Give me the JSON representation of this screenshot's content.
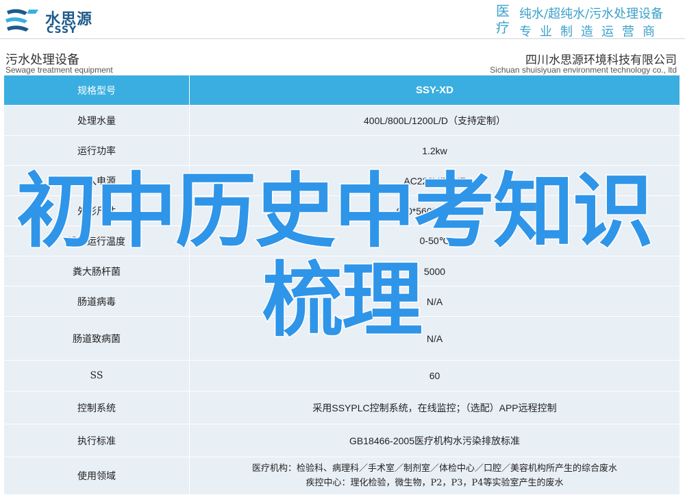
{
  "header": {
    "logo_cn": "水思源",
    "logo_en": "CSSY",
    "side_char_1": "医",
    "side_char_2": "疗",
    "tagline_1": "纯水/超纯水/污水处理设备",
    "tagline_2": "专业制造运营商"
  },
  "title": {
    "left_cn": "污水处理设备",
    "left_en": "Sewage treatment equipment",
    "right_cn": "四川水思源环境科技有限公司",
    "right_en": "Sichuan shuisiyuan environment technology co., ltd"
  },
  "table": {
    "header": {
      "label": "规格型号",
      "value": "SSY-XD"
    },
    "rows": [
      {
        "label": "处理水量",
        "value": "400L/800L/1200L/D（支持定制）"
      },
      {
        "label": "运行功率",
        "value": "1.2kw"
      },
      {
        "label": "输入电源",
        "value": "AC220V/50HZ"
      },
      {
        "label": "外形尺寸",
        "value": "680*560*1440mm"
      },
      {
        "label": "设备运行温度",
        "value": "0-50℃"
      },
      {
        "label": "粪大肠杆菌",
        "value": "5000"
      },
      {
        "label": "肠道病毒",
        "value": "N/A"
      },
      {
        "label": "肠道致病菌",
        "value": "N/A"
      },
      {
        "label": "SS",
        "value": "60"
      },
      {
        "label": "控制系统",
        "value": "采用SSYPLC控制系统，在线监控；（选配）APP远程控制"
      },
      {
        "label": "执行标准",
        "value": "GB18466-2005医疗机构水污染排放标准"
      }
    ],
    "last_row": {
      "label": "使用领域",
      "line1": "医疗机构：检验科、病理科／手术室／制剂室／体检中心／口腔／美容机构所产生的综合废水",
      "line2": "疾控中心：理化检验，微生物，P2，P3，P4等实验室产生的废水"
    }
  },
  "overlay": {
    "line1": "初中历史中考知识",
    "line2": "梳理"
  },
  "colors": {
    "accent": "#3aaee0",
    "row_bg": "#e8eff5",
    "overlay_text": "#2f95e8",
    "brand": "#1e5a8a"
  }
}
